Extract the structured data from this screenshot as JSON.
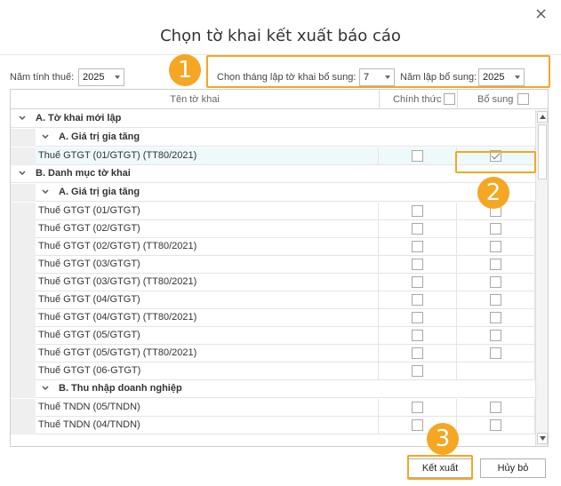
{
  "dialog": {
    "title": "Chọn tờ khai kết xuất báo cáo",
    "close_icon": "close-icon"
  },
  "filters": {
    "year_label": "Năm tính thuế:",
    "year_value": "2025",
    "month_label": "Chọn tháng lập tờ khai bổ sung:",
    "month_value": "7",
    "supp_year_label": "Năm lập bổ sung:",
    "supp_year_value": "2025"
  },
  "grid": {
    "headers": {
      "name": "Tên tờ khai",
      "official": "Chính thức",
      "supplement": "Bổ sung"
    },
    "groups": [
      {
        "label": "A. Tờ khai mới lập",
        "subgroups": [
          {
            "label": "A. Giá trị gia tăng",
            "rows": [
              {
                "name": "Thuế GTGT (01/GTGT) (TT80/2021)",
                "official": false,
                "supplement": true,
                "supplement_shown": true,
                "selected": true
              }
            ]
          }
        ]
      },
      {
        "label": "B. Danh mục tờ khai",
        "subgroups": [
          {
            "label": "A. Giá trị gia tăng",
            "rows": [
              {
                "name": "Thuế GTGT (01/GTGT)",
                "official": false,
                "supplement": false,
                "supplement_shown": true
              },
              {
                "name": "Thuế GTGT (02/GTGT)",
                "official": false,
                "supplement": false,
                "supplement_shown": true
              },
              {
                "name": "Thuế GTGT (02/GTGT) (TT80/2021)",
                "official": false,
                "supplement": false,
                "supplement_shown": true
              },
              {
                "name": "Thuế GTGT (03/GTGT)",
                "official": false,
                "supplement": false,
                "supplement_shown": true
              },
              {
                "name": "Thuế GTGT (03/GTGT) (TT80/2021)",
                "official": false,
                "supplement": false,
                "supplement_shown": true
              },
              {
                "name": "Thuế GTGT (04/GTGT)",
                "official": false,
                "supplement": false,
                "supplement_shown": true
              },
              {
                "name": "Thuế GTGT (04/GTGT) (TT80/2021)",
                "official": false,
                "supplement": false,
                "supplement_shown": true
              },
              {
                "name": "Thuế GTGT (05/GTGT)",
                "official": false,
                "supplement": false,
                "supplement_shown": true
              },
              {
                "name": "Thuế GTGT (05/GTGT) (TT80/2021)",
                "official": false,
                "supplement": false,
                "supplement_shown": true
              },
              {
                "name": "Thuế GTGT (06-GTGT)",
                "official": false,
                "supplement": false,
                "supplement_shown": false
              }
            ]
          },
          {
            "label": "B. Thu nhập doanh nghiệp",
            "rows": [
              {
                "name": "Thuế TNDN (05/TNDN)",
                "official": false,
                "supplement": false,
                "supplement_shown": true
              },
              {
                "name": "Thuế TNDN (04/TNDN)",
                "official": false,
                "supplement": false,
                "supplement_shown": true
              }
            ]
          }
        ]
      }
    ]
  },
  "actions": {
    "export": "Kết xuất",
    "cancel": "Hủy bỏ"
  },
  "callouts": [
    "1",
    "2",
    "3"
  ],
  "colors": {
    "highlight": "#f5a623",
    "selected_row": "#eef9fb",
    "group_band": "#efefef"
  }
}
